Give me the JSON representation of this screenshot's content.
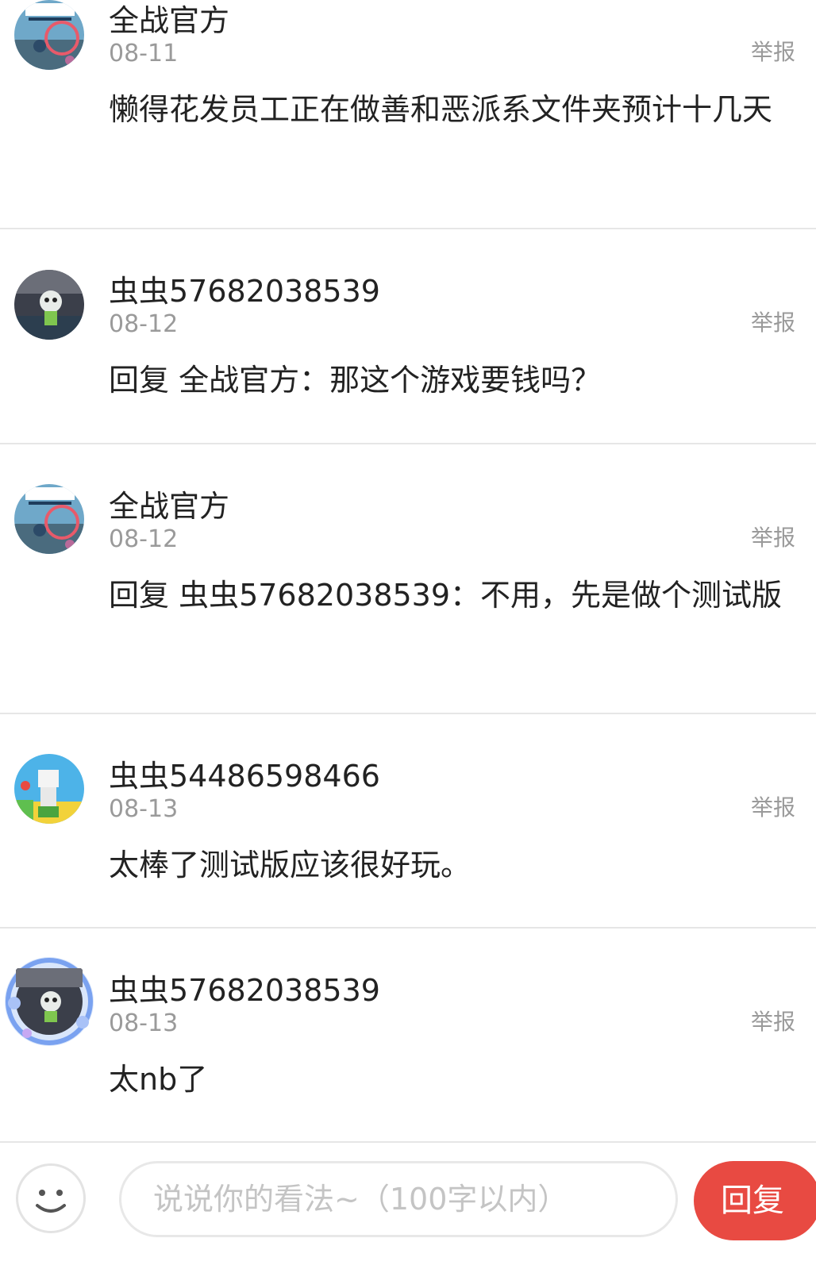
{
  "comments": [
    {
      "name": "全战官方",
      "date": "08-11",
      "report": "举报",
      "content": "懒得花发员工正在做善和恶派系文件夹预计十几天",
      "avatar": "tabs-game-avatar"
    },
    {
      "name": "虫虫57682038539",
      "date": "08-12",
      "report": "举报",
      "content": "回复 全战官方：那这个游戏要钱吗？",
      "avatar": "robot-character-avatar"
    },
    {
      "name": "全战官方",
      "date": "08-12",
      "report": "举报",
      "content": "回复 虫虫57682038539：不用，先是做个测试版",
      "avatar": "tabs-game-avatar"
    },
    {
      "name": "虫虫54486598466",
      "date": "08-13",
      "report": "举报",
      "content": "太棒了测试版应该很好玩。",
      "avatar": "blocky-character-avatar"
    },
    {
      "name": "虫虫57682038539",
      "date": "08-13",
      "report": "举报",
      "content": "太nb了",
      "avatar": "robot-character-framed-avatar"
    }
  ],
  "input": {
    "placeholder": "说说你的看法~（100字以内）"
  },
  "reply_button": "回复",
  "colors": {
    "accent": "#e84a42",
    "divider": "#e6e6e6",
    "muted_text": "#9a9a9a"
  }
}
